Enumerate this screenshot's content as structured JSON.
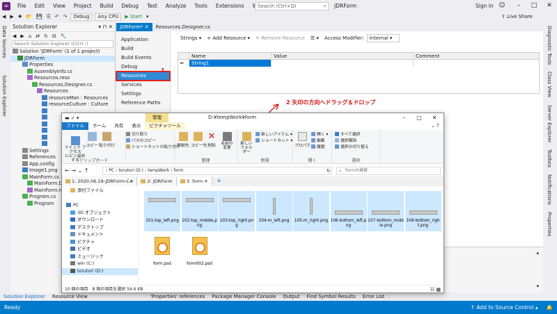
{
  "vs": {
    "menu": [
      "File",
      "Edit",
      "View",
      "Project",
      "Build",
      "Debug",
      "Test",
      "Analyze",
      "Tools",
      "Extensions",
      "Window",
      "Help"
    ],
    "search_placeholder": "Search (Ctrl+Q)",
    "solution_name": "JDRForm",
    "sign_in": "Sign in",
    "toolbar": {
      "config": "Debug",
      "platform": "Any CPU",
      "start": "▶ Start",
      "live_share": "Live Share"
    },
    "left_strip": [
      "Data Sources",
      "Solution Explorer"
    ],
    "right_strip": [
      "Diagnostic Tools",
      "Class View",
      "Server Explorer",
      "Toolbox",
      "Notifications",
      "Properties"
    ]
  },
  "solution_explorer": {
    "title": "Solution Explorer",
    "search_placeholder": "Search Solution Explorer (Ctrl+;)",
    "items": [
      {
        "label": "Solution 'JDRForm' (1 of 1 project)",
        "indent": 0,
        "icon": "ic-cfg",
        "sel": false
      },
      {
        "label": "JDRForm",
        "indent": 1,
        "icon": "ic-proj",
        "sel": true
      },
      {
        "label": "Properties",
        "indent": 2,
        "icon": "ic-prop",
        "sel": false
      },
      {
        "label": "AssemblyInfo.cs",
        "indent": 3,
        "icon": "ic-cs",
        "sel": false
      },
      {
        "label": "Resources.resx",
        "indent": 3,
        "icon": "ic-res",
        "sel": false
      },
      {
        "label": "Resources.Designer.cs",
        "indent": 4,
        "icon": "ic-cs",
        "sel": false
      },
      {
        "label": "Resources",
        "indent": 5,
        "icon": "ic-res",
        "sel": false
      },
      {
        "label": "resourceMan : Resources",
        "indent": 6,
        "icon": "ic-img",
        "sel": false
      },
      {
        "label": "resourceCulture : Culture",
        "indent": 6,
        "icon": "ic-img",
        "sel": false
      },
      {
        "label": "",
        "indent": 6,
        "icon": "ic-img",
        "sel": false
      },
      {
        "label": "",
        "indent": 6,
        "icon": "ic-img",
        "sel": false
      },
      {
        "label": "",
        "indent": 6,
        "icon": "ic-img",
        "sel": false
      },
      {
        "label": "",
        "indent": 6,
        "icon": "ic-img",
        "sel": false
      },
      {
        "label": "",
        "indent": 6,
        "icon": "ic-img",
        "sel": false
      },
      {
        "label": "",
        "indent": 6,
        "icon": "ic-img",
        "sel": false
      },
      {
        "label": "Settings",
        "indent": 2,
        "icon": "ic-cfg",
        "sel": false
      },
      {
        "label": "References",
        "indent": 2,
        "icon": "ic-cfg",
        "sel": false
      },
      {
        "label": "App.config",
        "indent": 2,
        "icon": "ic-cfg",
        "sel": false
      },
      {
        "label": "Image1.png",
        "indent": 2,
        "icon": "ic-img",
        "sel": false
      },
      {
        "label": "MainForm.cs",
        "indent": 2,
        "icon": "ic-cs",
        "sel": false
      },
      {
        "label": "MainForm.Designer.cs",
        "indent": 3,
        "icon": "ic-cs",
        "sel": false
      },
      {
        "label": "MainForm.resx",
        "indent": 3,
        "icon": "ic-res",
        "sel": false
      },
      {
        "label": "Program.cs",
        "indent": 2,
        "icon": "ic-cs",
        "sel": false
      },
      {
        "label": "Program",
        "indent": 3,
        "icon": "ic-cs",
        "sel": false
      }
    ]
  },
  "designer": {
    "tabs": [
      {
        "label": "JDRForm*  ✕",
        "active": true
      },
      {
        "label": "Resources.Designer.cs",
        "active": false
      }
    ],
    "nav": [
      {
        "label": "Application",
        "active": false
      },
      {
        "label": "Build",
        "active": false
      },
      {
        "label": "Build Events",
        "active": false
      },
      {
        "label": "Debug",
        "active": false
      },
      {
        "label": "Resources",
        "active": true
      },
      {
        "label": "Services",
        "active": false
      },
      {
        "label": "Settings",
        "active": false
      },
      {
        "label": "Reference Paths",
        "active": false
      }
    ],
    "res_toolbar": [
      "Strings ▾",
      "+ Add Resource ▾",
      "✕ Remove Resource",
      "☰ ▾",
      "Access Modifier:",
      "Internal ▾"
    ],
    "grid_headers": [
      "Name",
      "Value",
      "Comment"
    ],
    "grid_row": {
      "marker": "▸▸",
      "name": "String1",
      "value": "",
      "comment": ""
    },
    "annotation_1": "1",
    "annotation_2": "2  矢印の方向へドラッグ＆ドロップ"
  },
  "bottom_tabs": [
    "Solution Explorer",
    "Resource View",
    "'Properties' references",
    "Package Manager Console",
    "Output",
    "Find Symbol Results",
    "Error List"
  ],
  "status": {
    "ready": "Ready",
    "source_control": "↑ Add to Source Control ▴"
  },
  "explorer": {
    "manage": "管理",
    "title_path": "D:¥tempWork¥form",
    "ribbon_tabs": [
      "ファイル",
      "ホーム",
      "共有",
      "表示",
      "ピクチャツール"
    ],
    "ribbon": {
      "pin": "クイック アクセス\nにピン留めする",
      "copy": "コピー",
      "paste": "貼り付け",
      "cut": "切り取り",
      "copy_path": "パスのコピー",
      "paste_shortcut": "ショートカットの貼り付け",
      "clipboard": "クリップボード",
      "move_to": "移動先",
      "copy_to": "コピー先",
      "delete": "削除",
      "rename": "名前の\n変更",
      "organize": "整理",
      "new_folder": "新しい\nフォルダー",
      "new_item": "新しいアイテム ▾",
      "shortcut": "ショートカット ▾",
      "new": "新規",
      "properties": "プロパティ",
      "open": "開く ▾",
      "edit": "編集",
      "history": "履歴",
      "open_group": "開く",
      "select_all": "すべて選択",
      "select_none": "選択解除",
      "invert_selection": "選択の切り替え",
      "select": "選択"
    },
    "address": "›  PC  ›  torutori (D:)  ›  tempWork  ›  form",
    "search_placeholder": "formの検索",
    "tabs": [
      {
        "label": "1:  2020.06.19-JDRForm-C#",
        "active": false
      },
      {
        "label": "2:  JDRForm",
        "active": false
      },
      {
        "label": "3:  form  ✕",
        "active": true
      }
    ],
    "add_tab": "+",
    "nav": [
      {
        "label": "添付ファイル",
        "color": "#dcb35c",
        "sel": false
      },
      {
        "label": "",
        "color": "#ffffff",
        "sel": false
      },
      {
        "label": "PC",
        "color": "#3b7fc4",
        "sel": false
      },
      {
        "label": "3D オブジェクト",
        "color": "#4aa3df",
        "sel": false
      },
      {
        "label": "ダウンロード",
        "color": "#2f6fb8",
        "sel": false
      },
      {
        "label": "デスクトップ",
        "color": "#3b7fc4",
        "sel": false
      },
      {
        "label": "ドキュメント",
        "color": "#6b8fbf",
        "sel": false
      },
      {
        "label": "ピクチャ",
        "color": "#4a90d9",
        "sel": false
      },
      {
        "label": "ビデオ",
        "color": "#4a6fa5",
        "sel": false
      },
      {
        "label": "ミュージック",
        "color": "#3f7fbf",
        "sel": false
      },
      {
        "label": "win (C:)",
        "color": "#777",
        "sel": false
      },
      {
        "label": "torutori (D:)",
        "color": "#555",
        "sel": true
      }
    ],
    "files": [
      {
        "name": "101-top_left.png",
        "kind": "png",
        "sel": true
      },
      {
        "name": "102-top_middle.png",
        "kind": "png",
        "sel": true
      },
      {
        "name": "103-top_right.png",
        "kind": "png",
        "sel": true
      },
      {
        "name": "104-m_left.png",
        "kind": "png",
        "sel": true
      },
      {
        "name": "105-m_right.png",
        "kind": "png",
        "sel": true
      },
      {
        "name": "106-bottom_left.png",
        "kind": "png",
        "sel": true
      },
      {
        "name": "107-bottom_middle.png",
        "kind": "png",
        "sel": true
      },
      {
        "name": "108-bottom_right.png",
        "kind": "png",
        "sel": true
      },
      {
        "name": "form.psd",
        "kind": "psd",
        "sel": false
      },
      {
        "name": "form002.psd",
        "kind": "psd",
        "sel": false
      }
    ],
    "status": "10 個の項目　8 個の項目を選択  54.6 KB"
  }
}
